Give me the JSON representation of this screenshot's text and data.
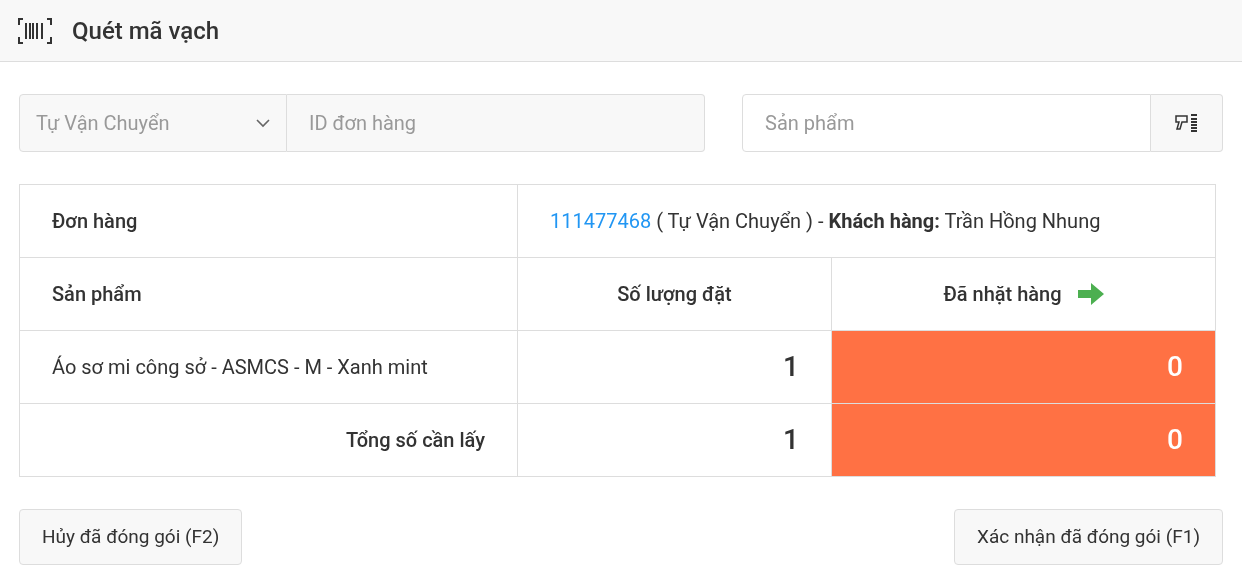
{
  "header": {
    "title": "Quét mã vạch"
  },
  "filters": {
    "carrier": "Tự Vận Chuyển",
    "order_placeholder": "ID đơn hàng",
    "product_placeholder": "Sản phẩm"
  },
  "order": {
    "label": "Đơn hàng",
    "id": "111477468",
    "details": "( Tự Vận Chuyển ) - **Khách hàng:** Trần Hồng Nhung"
  },
  "table": {
    "columns": [
      "Sản phẩm",
      "Số lượng đặt",
      "Đã nhặt hàng"
    ],
    "rows": [
      {
        "product": "Áo sơ mi công sở - ASMCS - M - Xanh mint",
        "ordered": "1",
        "picked": "0",
        "complete": false
      }
    ],
    "total": {
      "label": "Tổng số cần lấy",
      "ordered": "1",
      "picked": "0",
      "complete": false
    }
  },
  "buttons": {
    "cancel": "Hủy đã đóng gói (F2)",
    "confirm": "Xác nhận đã đóng gói (F1)"
  }
}
